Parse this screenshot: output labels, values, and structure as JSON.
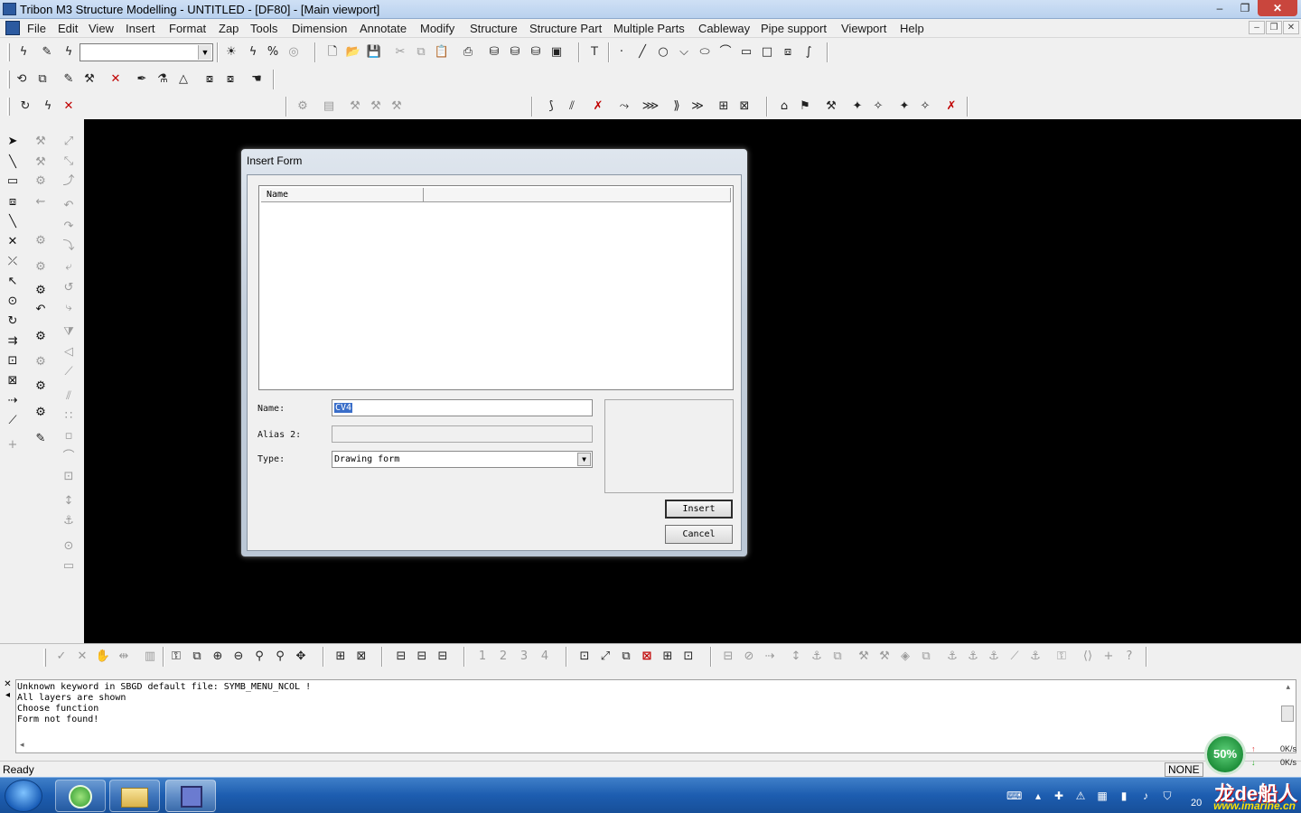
{
  "window": {
    "title": "Tribon M3 Structure Modelling - UNTITLED - [DF80] - [Main viewport]",
    "minimize": "–",
    "maximize": "❐",
    "close": "✕"
  },
  "menubar": {
    "items": [
      "File",
      "Edit",
      "View",
      "Insert",
      "Format",
      "Zap",
      "Tools",
      "Dimension",
      "Annotate",
      "Modify",
      "Structure",
      "Structure Part",
      "Multiple Parts",
      "Cableway",
      "Pipe support",
      "Viewport",
      "Help"
    ],
    "mdi_minimize": "–",
    "mdi_restore": "❐",
    "mdi_close": "✕"
  },
  "toolbar1": {
    "combo_value": ""
  },
  "dialog": {
    "title": "Insert Form",
    "list_column_1": "Name",
    "list_column_2": "",
    "name_label": "Name:",
    "name_value": "CV4",
    "alias_label": "Alias 2:",
    "alias_value": "",
    "type_label": "Type:",
    "type_value": "Drawing form",
    "insert_button": "Insert",
    "cancel_button": "Cancel"
  },
  "bottombar": {
    "viewport_numbers": [
      "1",
      "2",
      "3",
      "4"
    ]
  },
  "messages": {
    "lines": [
      "Unknown keyword in SBGD default file: SYMB_MENU_NCOL !",
      "All layers are shown",
      "Choose function",
      "Form not found!"
    ]
  },
  "statusbar": {
    "status": "Ready",
    "mode": "NONE"
  },
  "netmeter": {
    "percent": "50%",
    "upload": "0K/s",
    "download": "0K/s"
  },
  "taskbar": {
    "clock": "20",
    "watermark_cn": "龙de船人",
    "watermark_url": "www.imarine.cn"
  },
  "colors": {
    "canvas": "#000000",
    "selection": "#3a6ec9",
    "taskbar": "#1d5db0",
    "accent_red": "#c00000"
  }
}
